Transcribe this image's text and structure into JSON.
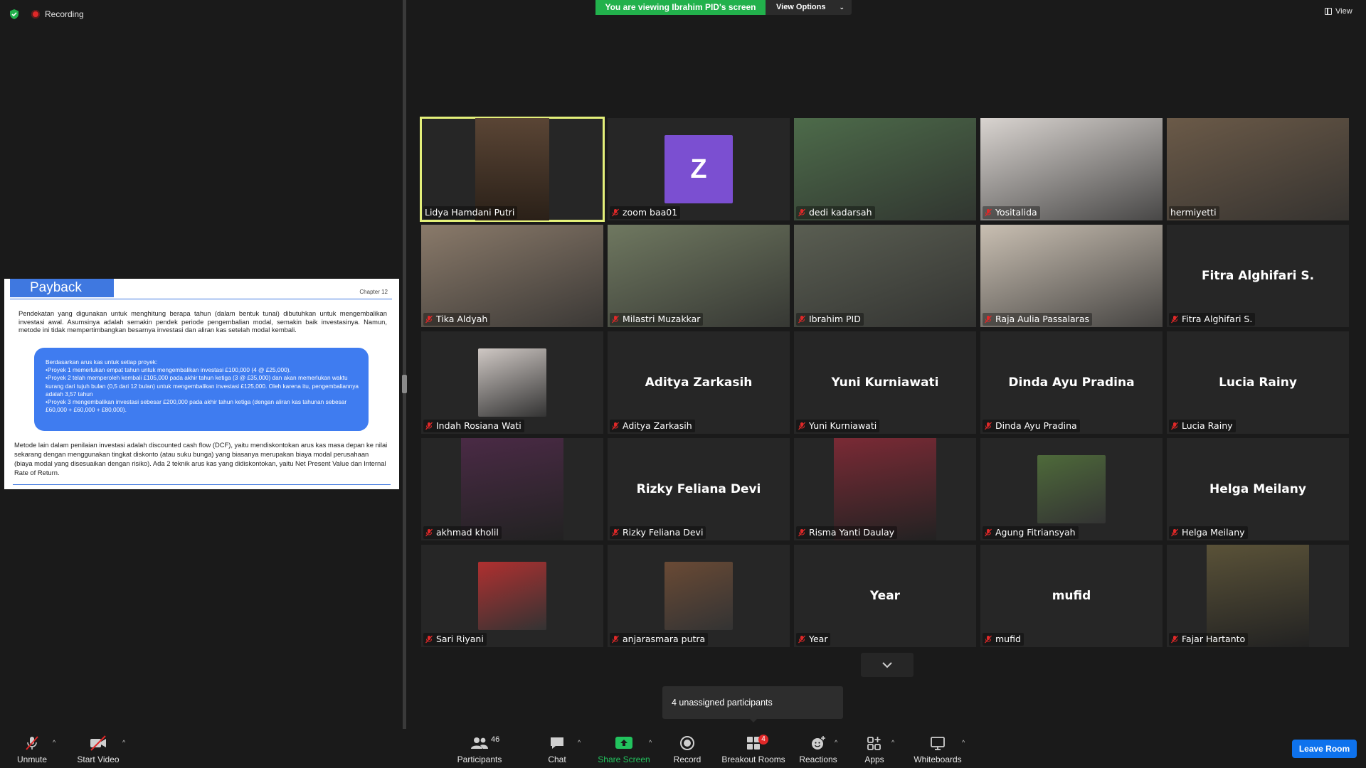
{
  "top": {
    "recording_label": "Recording",
    "viewing_banner": "You are viewing Ibrahim PID's screen",
    "view_options": "View Options",
    "view_label": "View"
  },
  "slide": {
    "title": "Payback",
    "chapter": "Chapter 12",
    "paragraph1": "Pendekatan yang digunakan untuk menghitung berapa tahun (dalam bentuk tunai) dibutuhkan untuk mengembalikan investasi awal. Asumsinya adalah semakin pendek periode pengembalian modal, semakin baik investasinya. Namun, metode ini tidak mempertimbangkan besarnya investasi dan aliran kas setelah modal kembali.",
    "box_lines": [
      "Berdasarkan arus kas untuk setiap proyek:",
      "•Proyek 1 memerlukan empat tahun untuk mengembalikan investasi £100,000 (4 @ £25,000).",
      "•Proyek 2 telah memperoleh kembali £105,000 pada akhir tahun ketiga (3 @ £35,000) dan akan memerlukan waktu kurang dari tujuh bulan (0,5 dari 12 bulan) untuk mengembalikan investasi £125,000. Oleh karena itu, pengembaliannya adalah 3,57 tahun",
      "•Proyek 3 mengembalikan investasi sebesar £200,000 pada akhir tahun ketiga (dengan aliran kas tahunan sebesar £60,000 + £60,000 + £80,000)."
    ],
    "paragraph2": "Metode lain dalam penilaian investasi adalah discounted cash flow (DCF), yaitu mendiskontokan arus kas masa depan ke nilai sekarang dengan menggunakan tingkat diskonto (atau suku bunga) yang biasanya merupakan biaya modal perusahaan (biaya modal yang disesuaikan dengan risiko). Ada 2 teknik arus kas yang didiskontokan, yaitu Net Present Value dan Internal Rate of Return."
  },
  "participants": [
    {
      "name": "Lidya Hamdani Putri",
      "muted": false,
      "kind": "video",
      "active": true,
      "bg": "#5a4535",
      "inset": true
    },
    {
      "name": "zoom baa01",
      "muted": true,
      "kind": "avatar",
      "letter": "Z",
      "color": "#7b4fd1"
    },
    {
      "name": "dedi kadarsah",
      "muted": true,
      "kind": "video",
      "bg": "#4d6b4a"
    },
    {
      "name": "Yositalida",
      "muted": true,
      "kind": "video",
      "bg": "#d9d4d0"
    },
    {
      "name": "hermiyetti",
      "muted": false,
      "kind": "video",
      "bg": "#6b5a48"
    },
    {
      "name": "Tika Aldyah",
      "muted": true,
      "kind": "video",
      "bg": "#8a7a6a"
    },
    {
      "name": "Milastri Muzakkar",
      "muted": true,
      "kind": "video",
      "bg": "#6f7860"
    },
    {
      "name": "Ibrahim PID",
      "muted": true,
      "kind": "video",
      "bg": "#5a5e52"
    },
    {
      "name": "Raja Aulia Passalaras",
      "muted": true,
      "kind": "video",
      "bg": "#c9bfb2"
    },
    {
      "name": "Fitra Alghifari S.",
      "muted": true,
      "kind": "name",
      "display": "Fitra Alghifari S."
    },
    {
      "name": "Indah Rosiana Wati",
      "muted": true,
      "kind": "photo",
      "bg": "#cfc8c4"
    },
    {
      "name": "Aditya Zarkasih",
      "muted": true,
      "kind": "name",
      "display": "Aditya Zarkasih"
    },
    {
      "name": "Yuni Kurniawati",
      "muted": true,
      "kind": "name",
      "display": "Yuni Kurniawati"
    },
    {
      "name": "Dinda Ayu Pradina",
      "muted": true,
      "kind": "name",
      "display": "Dinda Ayu Pradina"
    },
    {
      "name": "Lucia Rainy",
      "muted": true,
      "kind": "name",
      "display": "Lucia Rainy"
    },
    {
      "name": "akhmad kholil",
      "muted": true,
      "kind": "poster",
      "bg": "#4a2a45"
    },
    {
      "name": "Rizky Feliana Devi",
      "muted": true,
      "kind": "name",
      "display": "Rizky Feliana Devi"
    },
    {
      "name": "Risma Yanti Daulay",
      "muted": true,
      "kind": "poster",
      "bg": "#7a2a35"
    },
    {
      "name": "Agung Fitriansyah",
      "muted": true,
      "kind": "photo",
      "bg": "#4e6a3a"
    },
    {
      "name": "Helga Meilany",
      "muted": true,
      "kind": "name",
      "display": "Helga Meilany"
    },
    {
      "name": "Sari Riyani",
      "muted": true,
      "kind": "photo",
      "bg": "#b03030"
    },
    {
      "name": "anjarasmara putra",
      "muted": true,
      "kind": "photo",
      "bg": "#6a4a35"
    },
    {
      "name": "Year",
      "muted": true,
      "kind": "name",
      "display": "Year"
    },
    {
      "name": "mufid",
      "muted": true,
      "kind": "name",
      "display": "mufid"
    },
    {
      "name": "Fajar Hartanto",
      "muted": true,
      "kind": "poster",
      "bg": "#5a5238"
    }
  ],
  "unassigned": "4 unassigned participants",
  "toolbar": {
    "unmute": "Unmute",
    "start_video": "Start Video",
    "participants": "Participants",
    "participants_count": "46",
    "chat": "Chat",
    "share_screen": "Share Screen",
    "record": "Record",
    "breakout_rooms": "Breakout Rooms",
    "breakout_badge": "4",
    "reactions": "Reactions",
    "apps": "Apps",
    "whiteboards": "Whiteboards",
    "leave_room": "Leave Room"
  },
  "colors": {
    "share_green": "#22b14c",
    "leave_blue": "#0e72ed",
    "mute_red": "#e02828",
    "active_outline": "#e4f07a"
  }
}
